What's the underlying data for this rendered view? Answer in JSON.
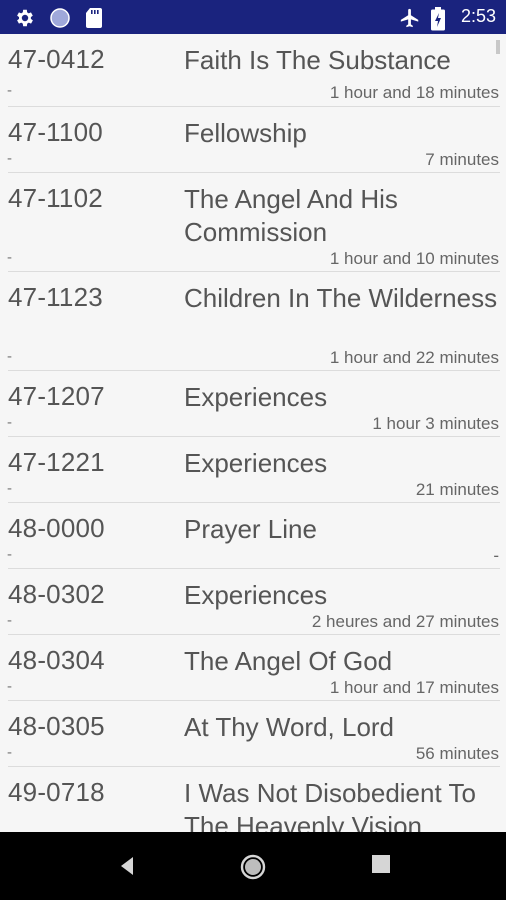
{
  "status": {
    "time": "2:53",
    "icons": [
      "gear-icon",
      "circle-icon",
      "sd-card-icon",
      "airplane-icon",
      "battery-icon"
    ]
  },
  "sermons": [
    {
      "code": "47-0412",
      "title": "Faith Is The Substance",
      "dash": "-",
      "duration": "1 hour and 18 minutes"
    },
    {
      "code": "47-1100",
      "title": "Fellowship",
      "dash": "-",
      "duration": "7 minutes"
    },
    {
      "code": "47-1102",
      "title": "The Angel And His Commission",
      "dash": "-",
      "duration": "1 hour and 10 minutes"
    },
    {
      "code": "47-1123",
      "title": "Children In The Wilderness",
      "dash": "-",
      "duration": "1 hour and 22 minutes"
    },
    {
      "code": "47-1207",
      "title": "Experiences",
      "dash": "-",
      "duration": "1 hour 3 minutes"
    },
    {
      "code": "47-1221",
      "title": "Experiences",
      "dash": "-",
      "duration": "21 minutes"
    },
    {
      "code": "48-0000",
      "title": "Prayer Line",
      "dash": "-",
      "duration": "-"
    },
    {
      "code": "48-0302",
      "title": "Experiences",
      "dash": "-",
      "duration": "2 heures and 27 minutes"
    },
    {
      "code": "48-0304",
      "title": "The Angel Of God",
      "dash": "-",
      "duration": "1 hour and 17 minutes"
    },
    {
      "code": "48-0305",
      "title": "At Thy Word, Lord",
      "dash": "-",
      "duration": "56 minutes"
    },
    {
      "code": "49-0718",
      "title": "I Was Not Disobedient To The Heavenly Vision",
      "dash": "",
      "duration": ""
    }
  ],
  "nav": {
    "icons": [
      "back-icon",
      "home-icon",
      "recents-icon"
    ]
  }
}
